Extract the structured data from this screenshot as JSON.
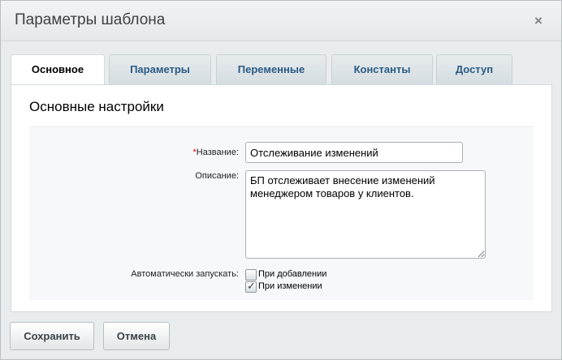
{
  "dialog": {
    "title": "Параметры шаблона",
    "close_symbol": "×"
  },
  "tabs": [
    {
      "label": "Основное",
      "active": true
    },
    {
      "label": "Параметры",
      "active": false
    },
    {
      "label": "Переменные",
      "active": false
    },
    {
      "label": "Константы",
      "active": false
    },
    {
      "label": "Доступ",
      "active": false
    }
  ],
  "section": {
    "title": "Основные настройки"
  },
  "form": {
    "name": {
      "required_mark": "*",
      "label": "Название:",
      "value": "Отслеживание изменений"
    },
    "description": {
      "label": "Описание:",
      "value": "БП отслеживает внесение изменений менеджером товаров у клиентов."
    },
    "autostart": {
      "label": "Автоматически запускать:",
      "options": [
        {
          "label": "При добавлении",
          "checked": false
        },
        {
          "label": "При изменении",
          "checked": true
        }
      ]
    }
  },
  "buttons": {
    "save": "Сохранить",
    "cancel": "Отмена"
  },
  "icons": {
    "close": "close-icon",
    "check": "checkmark-icon"
  }
}
